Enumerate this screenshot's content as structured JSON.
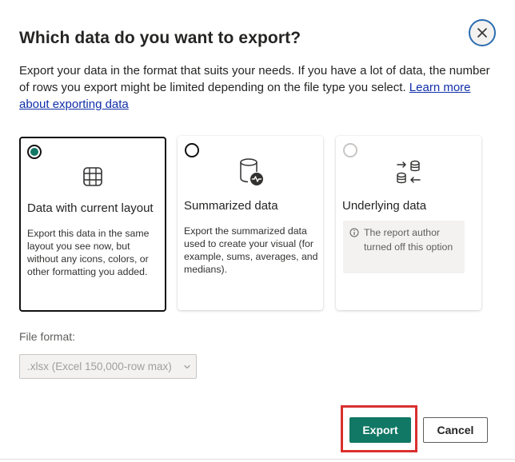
{
  "dialog": {
    "title": "Which data do you want to export?",
    "description": "Export your data in the format that suits your needs. If you have a lot of data, the number of rows you export might be limited depending on the file type you select.",
    "learn_more_link": "Learn more about exporting data",
    "close_icon": "close-icon"
  },
  "options": [
    {
      "title": "Data with current layout",
      "text": "Export this data in the same layout you see now, but without any icons, colors, or other formatting you added.",
      "selected": true,
      "icon": "table-icon"
    },
    {
      "title": "Summarized data",
      "text": "Export the summarized data used to create your visual (for example, sums, averages, and medians).",
      "selected": false,
      "icon": "database-chart-icon"
    },
    {
      "title": "Underlying data",
      "info": "The report author turned off this option",
      "selected": false,
      "disabled": true,
      "icon": "database-transfer-icon"
    }
  ],
  "file_format": {
    "label": "File format:",
    "value": ".xlsx (Excel 150,000-row max)"
  },
  "buttons": {
    "export": "Export",
    "cancel": "Cancel"
  },
  "colors": {
    "accent": "#117865",
    "highlight": "#d9302f"
  }
}
